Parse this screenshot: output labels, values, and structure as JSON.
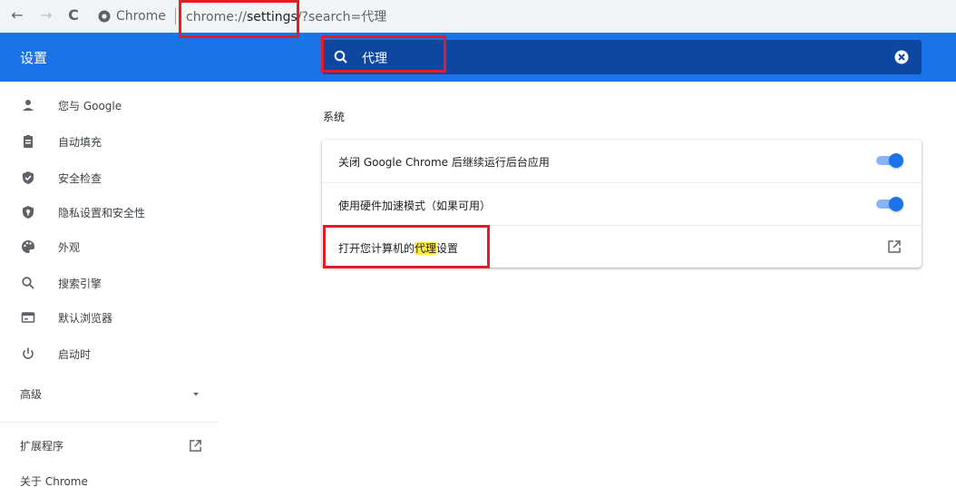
{
  "browser": {
    "back_glyph": "←",
    "forward_glyph": "→",
    "reload_glyph": "C",
    "site_chip_label": "Chrome",
    "url_prefix": "chrome://",
    "url_host": "settings",
    "url_path": "/?search=代理"
  },
  "header": {
    "title": "设置",
    "search_value": "代理"
  },
  "sidebar": {
    "items": [
      {
        "label": "您与 Google",
        "icon": "person-icon"
      },
      {
        "label": "自动填充",
        "icon": "clipboard-icon"
      },
      {
        "label": "安全检查",
        "icon": "shield-check-icon"
      },
      {
        "label": "隐私设置和安全性",
        "icon": "privacy-shield-icon"
      },
      {
        "label": "外观",
        "icon": "palette-icon"
      },
      {
        "label": "搜索引擎",
        "icon": "search-icon"
      },
      {
        "label": "默认浏览器",
        "icon": "browser-icon"
      },
      {
        "label": "启动时",
        "icon": "power-icon"
      }
    ],
    "advanced_label": "高级",
    "extensions_label": "扩展程序",
    "about_label": "关于 Chrome"
  },
  "main": {
    "section_title": "系统",
    "rows": [
      {
        "label": "关闭 Google Chrome 后继续运行后台应用",
        "toggle_on": true
      },
      {
        "label": "使用硬件加速模式（如果可用）",
        "toggle_on": true
      },
      {
        "label_before": "打开您计算机的",
        "label_highlight": "代理",
        "label_after": "设置",
        "control": "open-in-new-icon"
      }
    ]
  },
  "colors": {
    "accent": "#1a73e8",
    "search_bg": "#0d47a1",
    "highlight": "#ffeb3b",
    "annotation_red": "#e51c23"
  }
}
